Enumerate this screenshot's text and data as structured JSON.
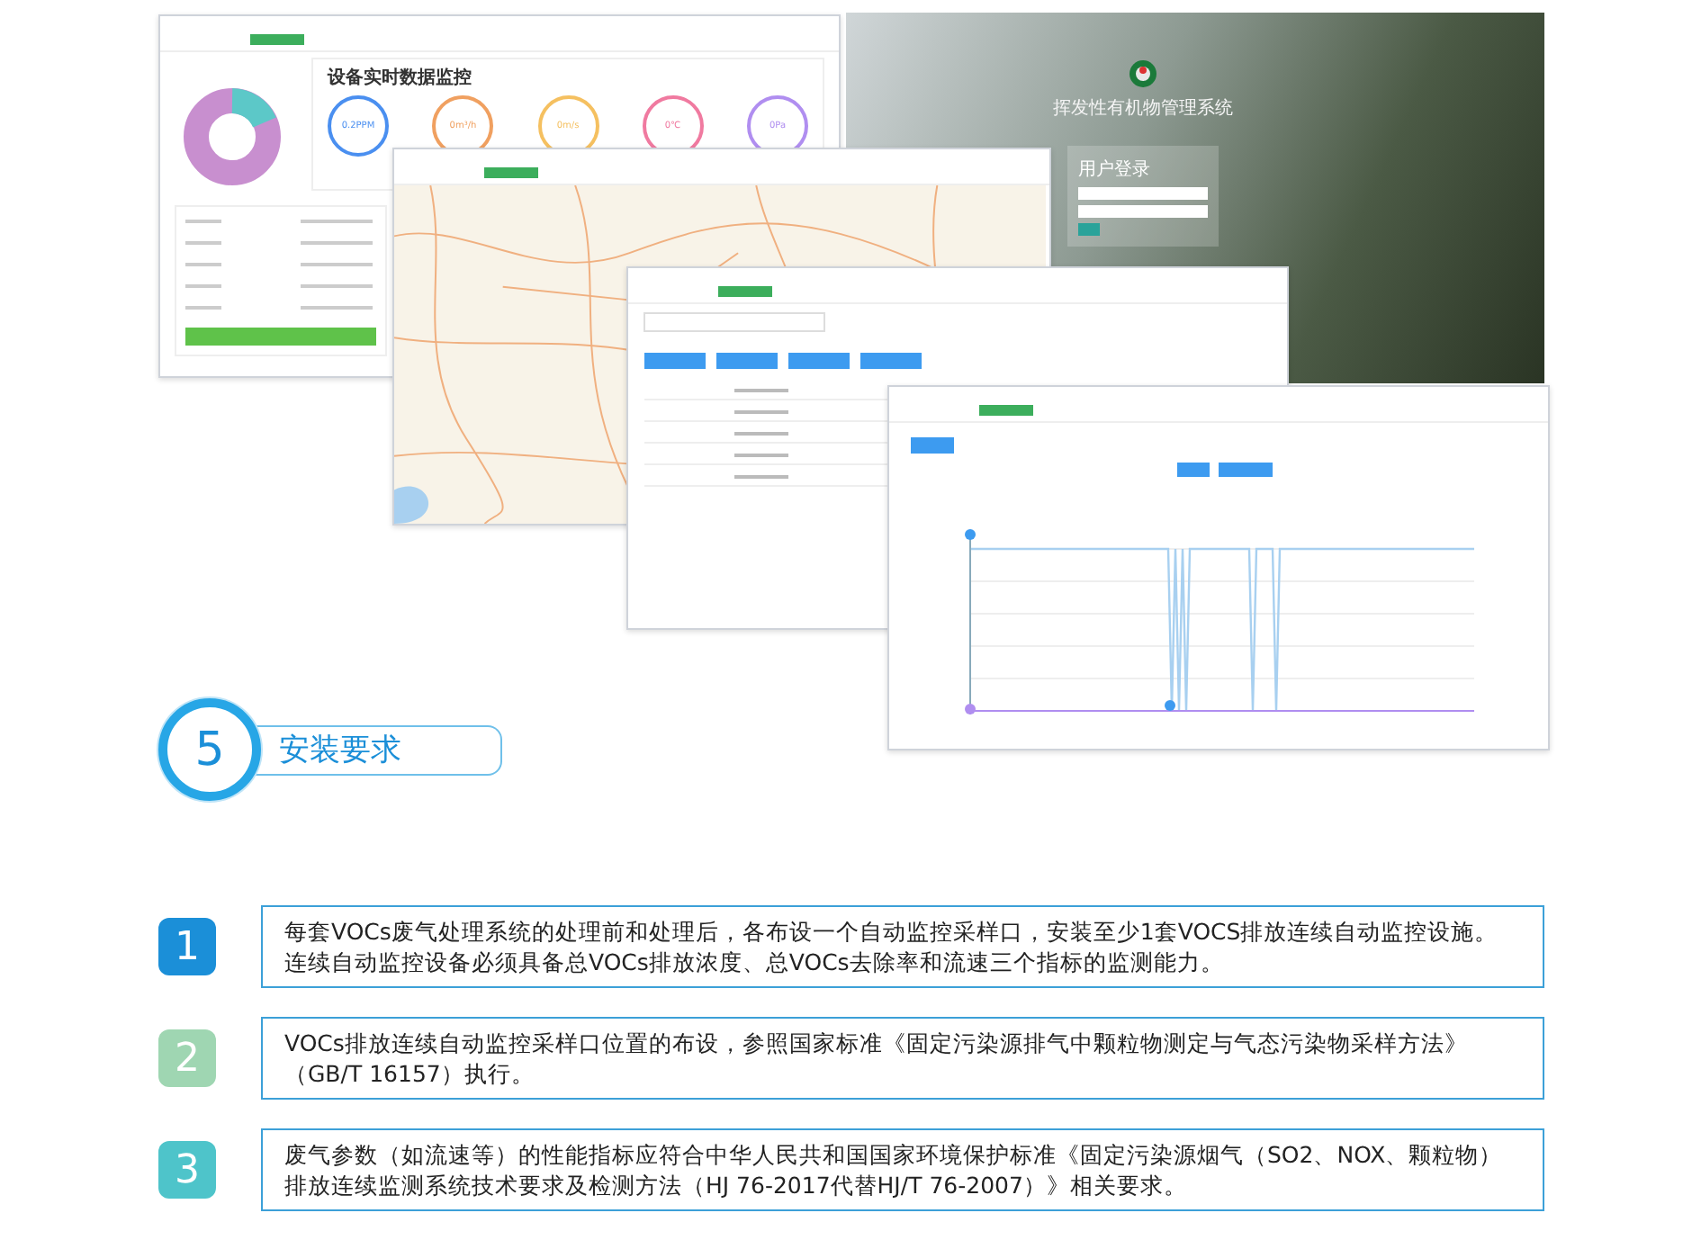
{
  "collage": {
    "dashboard": {
      "title": "设备实时数据监控",
      "gauges": [
        {
          "text": "0.2PPM",
          "color": "#4a8ff0"
        },
        {
          "text": "0m³/h",
          "color": "#f0a060"
        },
        {
          "text": "0m/s",
          "color": "#f5c060"
        },
        {
          "text": "0℃",
          "color": "#f07aa0"
        },
        {
          "text": "0Pa",
          "color": "#b08ef0"
        }
      ]
    },
    "login": {
      "system_title": "挥发性有机物管理系统",
      "panel_title": "用户登录"
    }
  },
  "section": {
    "number": "5",
    "title": "安装要求"
  },
  "requirements": [
    {
      "number": "1",
      "color": "#1b8fd8",
      "text": "每套VOCs废气处理系统的处理前和处理后，各布设一个自动监控采样口，安装至少1套VOCS排放连续自动监控设施。连续自动监控设备必须具备总VOCs排放浓度、总VOCs去除率和流速三个指标的监测能力。"
    },
    {
      "number": "2",
      "color": "#9fd6b2",
      "text": "VOCs排放连续自动监控采样口位置的布设，参照国家标准《固定污染源排气中颗粒物测定与气态污染物采样方法》（GB/T 16157）执行。"
    },
    {
      "number": "3",
      "color": "#4ec4ca",
      "text": "废气参数（如流速等）的性能指标应符合中华人民共和国国家环境保护标准《固定污染源烟气（SO2、NOX、颗粒物）排放连续监测系统技术要求及检测方法（HJ 76-2017代替HJ/T 76-2007）》相关要求。"
    }
  ]
}
